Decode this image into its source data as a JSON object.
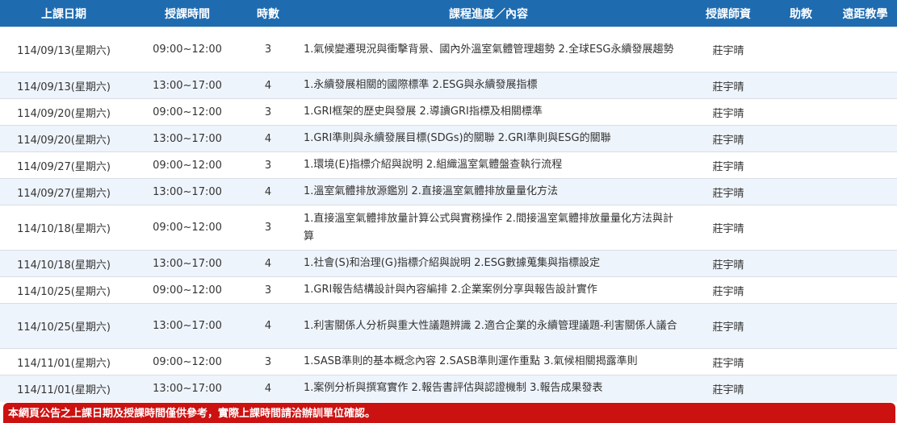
{
  "headers": [
    "上課日期",
    "授課時間",
    "時數",
    "課程進度／內容",
    "授課師資",
    "助教",
    "遠距教學"
  ],
  "rows": [
    {
      "date": "114/09/13(星期六)",
      "time": "09:00~12:00",
      "hours": "3",
      "content": "1.氣候變遷現況與衝擊背景、國內外溫室氣體管理趨勢 2.全球ESG永續發展趨勢",
      "teacher": "莊宇晴",
      "assistant": "",
      "remote": ""
    },
    {
      "date": "114/09/13(星期六)",
      "time": "13:00~17:00",
      "hours": "4",
      "content": "1.永續發展相關的國際標準 2.ESG與永續發展指標",
      "teacher": "莊宇晴",
      "assistant": "",
      "remote": ""
    },
    {
      "date": "114/09/20(星期六)",
      "time": "09:00~12:00",
      "hours": "3",
      "content": "1.GRI框架的歷史與發展 2.導讀GRI指標及相關標準",
      "teacher": "莊宇晴",
      "assistant": "",
      "remote": ""
    },
    {
      "date": "114/09/20(星期六)",
      "time": "13:00~17:00",
      "hours": "4",
      "content": "1.GRI準則與永續發展目標(SDGs)的關聯 2.GRI準則與ESG的關聯",
      "teacher": "莊宇晴",
      "assistant": "",
      "remote": ""
    },
    {
      "date": "114/09/27(星期六)",
      "time": "09:00~12:00",
      "hours": "3",
      "content": "1.環境(E)指標介紹與說明 2.組織溫室氣體盤查執行流程",
      "teacher": "莊宇晴",
      "assistant": "",
      "remote": ""
    },
    {
      "date": "114/09/27(星期六)",
      "time": "13:00~17:00",
      "hours": "4",
      "content": "1.溫室氣體排放源鑑別 2.直接溫室氣體排放量量化方法",
      "teacher": "莊宇晴",
      "assistant": "",
      "remote": ""
    },
    {
      "date": "114/10/18(星期六)",
      "time": "09:00~12:00",
      "hours": "3",
      "content": "1.直接溫室氣體排放量計算公式與實務操作 2.間接溫室氣體排放量量化方法與計算",
      "teacher": "莊宇晴",
      "assistant": "",
      "remote": ""
    },
    {
      "date": "114/10/18(星期六)",
      "time": "13:00~17:00",
      "hours": "4",
      "content": "1.社會(S)和治理(G)指標介紹與說明 2.ESG數據蒐集與指標設定",
      "teacher": "莊宇晴",
      "assistant": "",
      "remote": ""
    },
    {
      "date": "114/10/25(星期六)",
      "time": "09:00~12:00",
      "hours": "3",
      "content": "1.GRI報告結構設計與內容編排 2.企業案例分享與報告設計實作",
      "teacher": "莊宇晴",
      "assistant": "",
      "remote": ""
    },
    {
      "date": "114/10/25(星期六)",
      "time": "13:00~17:00",
      "hours": "4",
      "content": "1.利害關係人分析與重大性議題辨識 2.適合企業的永續管理議題-利害關係人議合",
      "teacher": "莊宇晴",
      "assistant": "",
      "remote": ""
    },
    {
      "date": "114/11/01(星期六)",
      "time": "09:00~12:00",
      "hours": "3",
      "content": "1.SASB準則的基本概念內容 2.SASB準則運作重點 3.氣候相關揭露準則",
      "teacher": "莊宇晴",
      "assistant": "",
      "remote": ""
    },
    {
      "date": "114/11/01(星期六)",
      "time": "13:00~17:00",
      "hours": "4",
      "content": "1.案例分析與撰寫實作 2.報告書評估與認證機制 3.報告成果發表",
      "teacher": "莊宇晴",
      "assistant": "",
      "remote": ""
    }
  ],
  "notice": "本網頁公告之上課日期及授課時間僅供參考，實際上課時間請洽辦訓單位確認。",
  "colors": {
    "header_bg": "#1E6BB0",
    "row_alt_bg": "#EEF4FB",
    "notice_bg": "#CC1111"
  }
}
